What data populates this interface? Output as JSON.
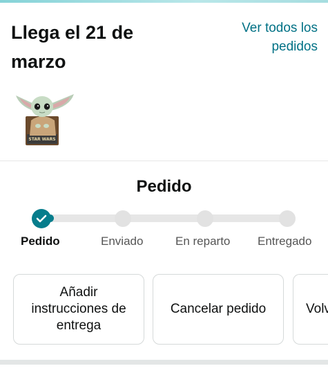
{
  "arrival": {
    "title": "Llega el 21 de marzo",
    "all_orders_link": "Ver todos los pedidos"
  },
  "product": {
    "icon": "plush-toy-thumbnail",
    "box_text": "STAR WARS"
  },
  "status": {
    "title": "Pedido",
    "progress_fraction": 0.0,
    "accent_color": "#067d8c",
    "steps": [
      {
        "label": "Pedido",
        "state": "complete"
      },
      {
        "label": "Enviado",
        "state": "pending"
      },
      {
        "label": "En reparto",
        "state": "pending"
      },
      {
        "label": "Entregado",
        "state": "pending"
      }
    ]
  },
  "actions": [
    {
      "label": "Añadir instrucciones de entrega"
    },
    {
      "label": "Cancelar pedido"
    },
    {
      "label": "Volv"
    }
  ]
}
